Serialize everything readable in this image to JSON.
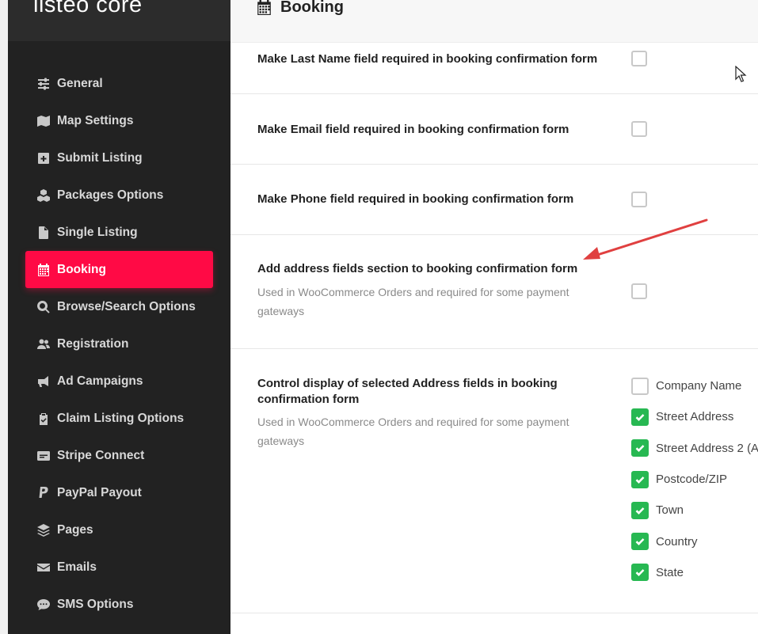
{
  "brand": {
    "text": "listeo core"
  },
  "sidebar": {
    "items": [
      {
        "label": "General",
        "icon": "sliders-icon",
        "active": false
      },
      {
        "label": "Map Settings",
        "icon": "map-icon",
        "active": false
      },
      {
        "label": "Submit Listing",
        "icon": "plus-square-icon",
        "active": false
      },
      {
        "label": "Packages Options",
        "icon": "cubes-icon",
        "active": false
      },
      {
        "label": "Single Listing",
        "icon": "file-icon",
        "active": false
      },
      {
        "label": "Booking",
        "icon": "calendar-icon",
        "active": true
      },
      {
        "label": "Browse/Search Options",
        "icon": "search-icon",
        "active": false
      },
      {
        "label": "Registration",
        "icon": "users-icon",
        "active": false
      },
      {
        "label": "Ad Campaigns",
        "icon": "megaphone-icon",
        "active": false
      },
      {
        "label": "Claim Listing Options",
        "icon": "clipboard-check-icon",
        "active": false
      },
      {
        "label": "Stripe Connect",
        "icon": "stripe-icon",
        "active": false
      },
      {
        "label": "PayPal Payout",
        "icon": "paypal-icon",
        "active": false
      },
      {
        "label": "Pages",
        "icon": "layers-icon",
        "active": false
      },
      {
        "label": "Emails",
        "icon": "envelope-icon",
        "active": false
      },
      {
        "label": "SMS Options",
        "icon": "sms-icon",
        "active": false
      }
    ]
  },
  "header": {
    "title": "Booking",
    "icon": "calendar-icon"
  },
  "settings": {
    "last_name": {
      "label": "Make Last Name field required in booking confirmation form",
      "checked": false
    },
    "email": {
      "label": "Make Email field required in booking confirmation form",
      "checked": false
    },
    "phone": {
      "label": "Make Phone field required in booking confirmation form",
      "checked": false
    },
    "address_section": {
      "label": "Add address fields section to booking confirmation form",
      "desc": "Used in WooCommerce Orders and required for some payment gateways",
      "checked": false
    },
    "address_fields": {
      "label": "Control display of selected Address fields in booking confirmation form",
      "desc": "Used in WooCommerce Orders and required for some payment gateways",
      "options": [
        {
          "label": "Company Name",
          "checked": false
        },
        {
          "label": "Street Address",
          "checked": true
        },
        {
          "label": "Street Address 2 (A",
          "checked": true
        },
        {
          "label": "Postcode/ZIP",
          "checked": true
        },
        {
          "label": "Town",
          "checked": true
        },
        {
          "label": "Country",
          "checked": true
        },
        {
          "label": "State",
          "checked": true
        }
      ]
    }
  },
  "colors": {
    "accent": "#ff0a45",
    "check": "#27b852",
    "sidebar_bg": "#222222",
    "annotation_arrow": "#e04040"
  }
}
